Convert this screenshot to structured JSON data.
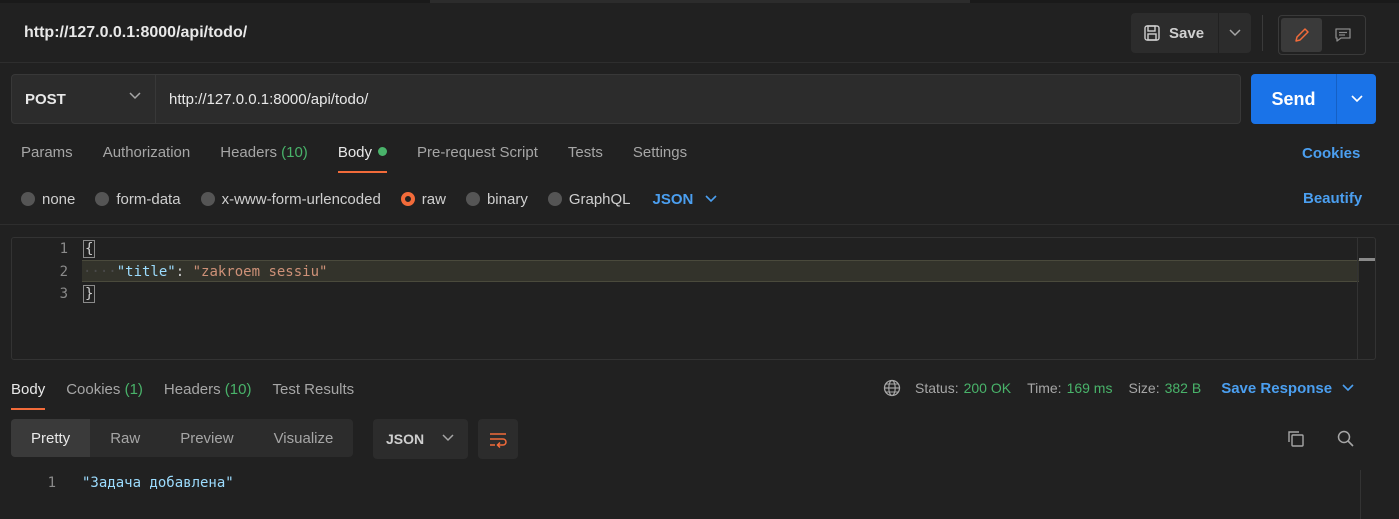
{
  "header": {
    "title": "http://127.0.0.1:8000/api/todo/",
    "save_label": "Save"
  },
  "request": {
    "method": "POST",
    "url": "http://127.0.0.1:8000/api/todo/",
    "send_label": "Send"
  },
  "request_tabs": {
    "params": "Params",
    "authorization": "Authorization",
    "headers": "Headers",
    "headers_count": "(10)",
    "body": "Body",
    "pre_request": "Pre-request Script",
    "tests": "Tests",
    "settings": "Settings",
    "cookies_link": "Cookies"
  },
  "body_types": {
    "none": "none",
    "form_data": "form-data",
    "urlencoded": "x-www-form-urlencoded",
    "raw": "raw",
    "binary": "binary",
    "graphql": "GraphQL",
    "selected": "raw",
    "language": "JSON",
    "beautify": "Beautify"
  },
  "editor": {
    "line_numbers": [
      "1",
      "2",
      "3"
    ],
    "open_brace": "{",
    "indent": "····",
    "key": "\"title\"",
    "colon": ": ",
    "value": "\"zakroem sessiu\"",
    "close_brace": "}"
  },
  "response_tabs": {
    "body": "Body",
    "cookies": "Cookies",
    "cookies_count": "(1)",
    "headers": "Headers",
    "headers_count": "(10)",
    "test_results": "Test Results"
  },
  "response_meta": {
    "status_label": "Status:",
    "status_value": "200 OK",
    "time_label": "Time:",
    "time_value": "169 ms",
    "size_label": "Size:",
    "size_value": "382 B",
    "save_response": "Save Response"
  },
  "response_view": {
    "pretty": "Pretty",
    "raw": "Raw",
    "preview": "Preview",
    "visualize": "Visualize",
    "format": "JSON"
  },
  "response_body": {
    "line_number": "1",
    "line": "\"Задача добавлена\""
  },
  "colors": {
    "accent_orange": "#f26b3a",
    "send_blue": "#1a73e8",
    "link_blue": "#4b9ff0",
    "success_green": "#49b36a"
  },
  "icons": {
    "save": "save-icon",
    "edit": "pencil-icon",
    "comment": "comment-icon",
    "globe": "globe-icon",
    "wrap": "wrap-lines-icon",
    "copy": "copy-icon",
    "search": "search-icon"
  }
}
